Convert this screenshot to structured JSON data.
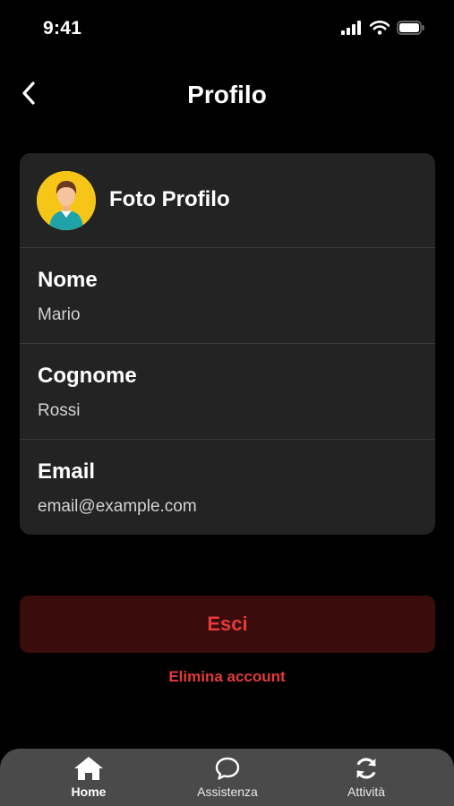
{
  "status_bar": {
    "time": "9:41"
  },
  "header": {
    "title": "Profilo",
    "back_icon": "chevron-left-icon"
  },
  "profile": {
    "photo_label": "Foto Profilo",
    "avatar_icon": "user-avatar",
    "fields": [
      {
        "label": "Nome",
        "value": "Mario"
      },
      {
        "label": "Cognome",
        "value": "Rossi"
      },
      {
        "label": "Email",
        "value": "email@example.com"
      }
    ]
  },
  "actions": {
    "logout_label": "Esci",
    "delete_label": "Elimina account"
  },
  "tab_bar": {
    "items": [
      {
        "label": "Home",
        "icon": "home-icon",
        "active": true
      },
      {
        "label": "Assistenza",
        "icon": "chat-bubble-icon",
        "active": false
      },
      {
        "label": "Attività",
        "icon": "refresh-icon",
        "active": false
      }
    ]
  },
  "colors": {
    "background": "#000000",
    "card": "#232323",
    "accent_red": "#e63a3a",
    "logout_bg": "#3a0c0c",
    "avatar_bg": "#f5c518",
    "tab_bar": "#4a4a4a"
  }
}
